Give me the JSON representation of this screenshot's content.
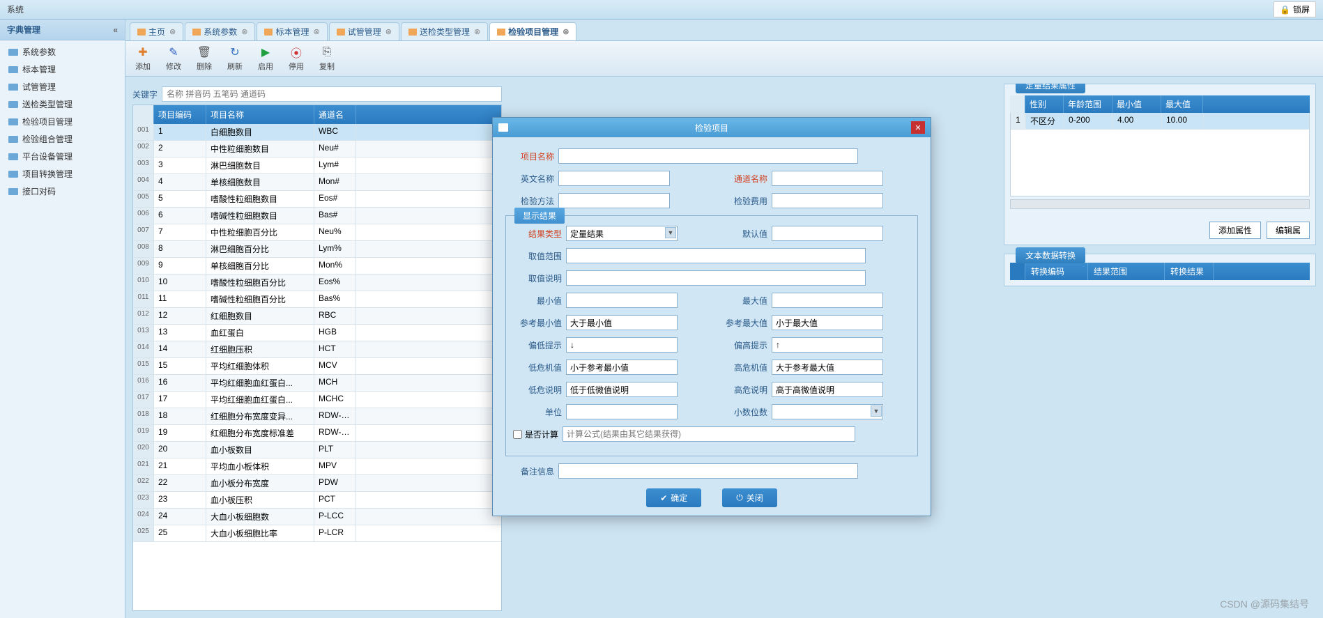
{
  "topbar": {
    "menu": "系统",
    "lock": "锁屏"
  },
  "sidebar": {
    "title": "字典管理",
    "items": [
      "系统参数",
      "标本管理",
      "试管管理",
      "送检类型管理",
      "检验项目管理",
      "检验组合管理",
      "平台设备管理",
      "项目转换管理",
      "接口对码"
    ]
  },
  "tabs": [
    "主页",
    "系统参数",
    "标本管理",
    "试管管理",
    "送检类型管理",
    "检验项目管理"
  ],
  "toolbar": [
    {
      "label": "添加",
      "glyph": "✚",
      "color": "#e08030"
    },
    {
      "label": "修改",
      "glyph": "✎",
      "color": "#3060c0"
    },
    {
      "label": "删除",
      "glyph": "🗑",
      "color": "#555"
    },
    {
      "label": "刷新",
      "glyph": "↻",
      "color": "#3070c0"
    },
    {
      "label": "启用",
      "glyph": "▶",
      "color": "#20a040"
    },
    {
      "label": "停用",
      "glyph": "⦿",
      "color": "#d03030"
    },
    {
      "label": "复制",
      "glyph": "⎘",
      "color": "#555"
    }
  ],
  "search": {
    "label": "关键字",
    "placeholder": "名称 拼音码 五笔码 通道码"
  },
  "grid": {
    "headers": [
      "项目编码",
      "项目名称",
      "通道名"
    ],
    "rows": [
      {
        "n": "001",
        "code": "1",
        "name": "白细胞数目",
        "chan": "WBC"
      },
      {
        "n": "002",
        "code": "2",
        "name": "中性粒细胞数目",
        "chan": "Neu#"
      },
      {
        "n": "003",
        "code": "3",
        "name": "淋巴细胞数目",
        "chan": "Lym#"
      },
      {
        "n": "004",
        "code": "4",
        "name": "单核细胞数目",
        "chan": "Mon#"
      },
      {
        "n": "005",
        "code": "5",
        "name": "嗜酸性粒细胞数目",
        "chan": "Eos#"
      },
      {
        "n": "006",
        "code": "6",
        "name": "嗜碱性粒细胞数目",
        "chan": "Bas#"
      },
      {
        "n": "007",
        "code": "7",
        "name": "中性粒细胞百分比",
        "chan": "Neu%"
      },
      {
        "n": "008",
        "code": "8",
        "name": "淋巴细胞百分比",
        "chan": "Lym%"
      },
      {
        "n": "009",
        "code": "9",
        "name": "单核细胞百分比",
        "chan": "Mon%"
      },
      {
        "n": "010",
        "code": "10",
        "name": "嗜酸性粒细胞百分比",
        "chan": "Eos%"
      },
      {
        "n": "011",
        "code": "11",
        "name": "嗜碱性粒细胞百分比",
        "chan": "Bas%"
      },
      {
        "n": "012",
        "code": "12",
        "name": "红细胞数目",
        "chan": "RBC"
      },
      {
        "n": "013",
        "code": "13",
        "name": "血红蛋白",
        "chan": "HGB"
      },
      {
        "n": "014",
        "code": "14",
        "name": "红细胞压积",
        "chan": "HCT"
      },
      {
        "n": "015",
        "code": "15",
        "name": "平均红细胞体积",
        "chan": "MCV"
      },
      {
        "n": "016",
        "code": "16",
        "name": "平均红细胞血红蛋白...",
        "chan": "MCH"
      },
      {
        "n": "017",
        "code": "17",
        "name": "平均红细胞血红蛋白...",
        "chan": "MCHC"
      },
      {
        "n": "018",
        "code": "18",
        "name": "红细胞分布宽度变异...",
        "chan": "RDW-CV"
      },
      {
        "n": "019",
        "code": "19",
        "name": "红细胞分布宽度标准差",
        "chan": "RDW-SD"
      },
      {
        "n": "020",
        "code": "20",
        "name": "血小板数目",
        "chan": "PLT"
      },
      {
        "n": "021",
        "code": "21",
        "name": "平均血小板体积",
        "chan": "MPV"
      },
      {
        "n": "022",
        "code": "22",
        "name": "血小板分布宽度",
        "chan": "PDW"
      },
      {
        "n": "023",
        "code": "23",
        "name": "血小板压积",
        "chan": "PCT"
      },
      {
        "n": "024",
        "code": "24",
        "name": "大血小板细胞数",
        "chan": "P-LCC"
      },
      {
        "n": "025",
        "code": "25",
        "name": "大血小板细胞比率",
        "chan": "P-LCR"
      }
    ]
  },
  "dialog": {
    "title": "检验项目",
    "labels": {
      "project_name": "项目名称",
      "english_name": "英文名称",
      "channel_name": "通道名称",
      "test_method": "检验方法",
      "test_fee": "检验费用",
      "show_result": "显示结果",
      "result_type": "结果类型",
      "default_val": "默认值",
      "value_range": "取值范围",
      "value_desc": "取值说明",
      "min_val": "最小值",
      "max_val": "最大值",
      "ref_min": "参考最小值",
      "ref_max": "参考最大值",
      "low_tip": "偏低提示",
      "high_tip": "偏高提示",
      "low_risk": "低危机值",
      "high_risk": "高危机值",
      "low_desc": "低危说明",
      "high_desc": "高危说明",
      "unit": "单位",
      "decimals": "小数位数",
      "is_calc": "是否计算",
      "remark": "备注信息"
    },
    "values": {
      "result_type": "定量结果",
      "ref_min": "大于最小值",
      "ref_max": "小于最大值",
      "low_tip": "↓",
      "high_tip": "↑",
      "low_risk": "小于参考最小值",
      "high_risk": "大于参考最大值",
      "low_desc": "低于低微值说明",
      "high_desc": "高于高微值说明",
      "calc_placeholder": "计算公式(结果由其它结果获得)"
    },
    "buttons": {
      "ok": "确定",
      "cancel": "关闭"
    }
  },
  "prop": {
    "title": "定量结果属性",
    "headers": [
      "性别",
      "年龄范围",
      "最小值",
      "最大值"
    ],
    "row": {
      "n": "1",
      "sex": "不区分",
      "age": "0-200",
      "min": "4.00",
      "max": "10.00"
    },
    "btns": {
      "add": "添加属性",
      "edit": "编辑属"
    }
  },
  "conv": {
    "title": "文本数据转换",
    "headers": [
      "转换编码",
      "结果范围",
      "转换结果"
    ]
  },
  "watermark": "CSDN @源码集结号"
}
